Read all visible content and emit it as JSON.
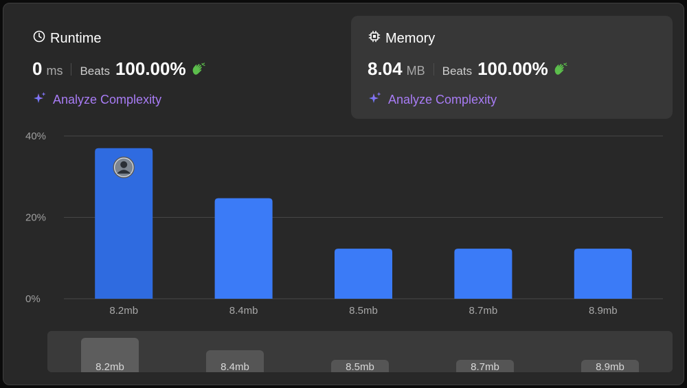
{
  "runtime": {
    "title": "Runtime",
    "value": "0",
    "unit": "ms",
    "beats_label": "Beats",
    "beats_pct": "100.00%",
    "analyze_label": "Analyze Complexity"
  },
  "memory": {
    "title": "Memory",
    "value": "8.04",
    "unit": "MB",
    "beats_label": "Beats",
    "beats_pct": "100.00%",
    "analyze_label": "Analyze Complexity"
  },
  "colors": {
    "bar": "#3b7bf7",
    "bar_selected": "#2f6be0",
    "accent_purple": "#a87cf5",
    "clap_green": "#5cbe4c"
  },
  "chart_data": {
    "type": "bar",
    "categories": [
      "8.2mb",
      "8.4mb",
      "8.5mb",
      "8.7mb",
      "8.9mb"
    ],
    "values": [
      37.0,
      24.7,
      12.3,
      12.3,
      12.3
    ],
    "yticks": [
      "0%",
      "20%",
      "40%"
    ],
    "ylim": [
      0,
      40
    ],
    "selected_index": 0,
    "grid": true
  },
  "scroller": {
    "labels": [
      "8.2mb",
      "8.4mb",
      "8.5mb",
      "8.7mb",
      "8.9mb"
    ]
  }
}
